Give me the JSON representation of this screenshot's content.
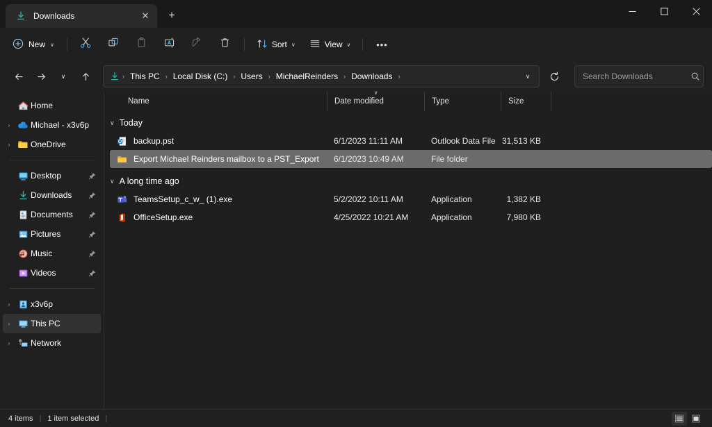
{
  "window": {
    "minimize_label": "Minimize",
    "maximize_label": "Maximize",
    "close_label": "Close"
  },
  "tabs": {
    "items": [
      {
        "label": "Downloads",
        "icon": "download-icon",
        "active": true
      }
    ],
    "close_label": "✕",
    "new_tab_label": "+"
  },
  "toolbar": {
    "new_label": "New",
    "new_chevron": "∨",
    "cut_label": "Cut",
    "copy_label": "Copy",
    "paste_label": "Paste",
    "rename_label": "Rename",
    "share_label": "Share",
    "delete_label": "Delete",
    "sort_label": "Sort",
    "sort_chevron": "∨",
    "view_label": "View",
    "view_chevron": "∨",
    "more_label": "•••"
  },
  "addressbar": {
    "back_label": "←",
    "forward_label": "→",
    "recent_chevron": "∨",
    "up_label": "↑",
    "refresh_label": "↻",
    "breadcrumb_separator": "›",
    "crumbs": [
      {
        "label": "This PC"
      },
      {
        "label": "Local Disk (C:)"
      },
      {
        "label": "Users"
      },
      {
        "label": "MichaelReinders"
      },
      {
        "label": "Downloads"
      }
    ],
    "dropdown_chevron": "∨"
  },
  "search": {
    "placeholder": "Search Downloads",
    "value": ""
  },
  "sidebar": {
    "groups": [
      {
        "items": [
          {
            "label": "Home",
            "icon": "home-icon",
            "expandable": false,
            "pinned": false,
            "selected": false
          },
          {
            "label": "Michael - x3v6p",
            "icon": "onedrive-cloud-icon",
            "expandable": true,
            "pinned": false,
            "selected": false
          },
          {
            "label": "OneDrive",
            "icon": "onedrive-folder-icon",
            "expandable": true,
            "pinned": false,
            "selected": false
          }
        ]
      },
      {
        "items": [
          {
            "label": "Desktop",
            "icon": "desktop-icon",
            "expandable": false,
            "pinned": true,
            "selected": false
          },
          {
            "label": "Downloads",
            "icon": "download-icon",
            "expandable": false,
            "pinned": true,
            "selected": false
          },
          {
            "label": "Documents",
            "icon": "documents-icon",
            "expandable": false,
            "pinned": true,
            "selected": false
          },
          {
            "label": "Pictures",
            "icon": "pictures-icon",
            "expandable": false,
            "pinned": true,
            "selected": false
          },
          {
            "label": "Music",
            "icon": "music-icon",
            "expandable": false,
            "pinned": true,
            "selected": false
          },
          {
            "label": "Videos",
            "icon": "videos-icon",
            "expandable": false,
            "pinned": true,
            "selected": false
          }
        ]
      },
      {
        "items": [
          {
            "label": "x3v6p",
            "icon": "pc-icon",
            "expandable": true,
            "pinned": false,
            "selected": false
          },
          {
            "label": "This PC",
            "icon": "this-pc-icon",
            "expandable": true,
            "pinned": false,
            "selected": true
          },
          {
            "label": "Network",
            "icon": "network-icon",
            "expandable": true,
            "pinned": false,
            "selected": false
          }
        ]
      }
    ],
    "expand_chevron": "›",
    "pin_glyph": "📌"
  },
  "columns": [
    {
      "key": "name",
      "label": "Name",
      "sorted": false
    },
    {
      "key": "date",
      "label": "Date modified",
      "sorted": true
    },
    {
      "key": "type",
      "label": "Type",
      "sorted": false
    },
    {
      "key": "size",
      "label": "Size",
      "sorted": false
    }
  ],
  "sort_indicator": "∨",
  "groups": [
    {
      "name": "Today",
      "chevron": "∨",
      "rows": [
        {
          "name": "backup.pst",
          "date": "6/1/2023 11:11 AM",
          "type": "Outlook Data File",
          "size": "31,513 KB",
          "icon": "outlook-data-file-icon",
          "selected": false
        },
        {
          "name": "Export Michael Reinders mailbox to a PST_Export",
          "date": "6/1/2023 10:49 AM",
          "type": "File folder",
          "size": "",
          "icon": "folder-icon",
          "selected": true
        }
      ]
    },
    {
      "name": "A long time ago",
      "chevron": "∨",
      "rows": [
        {
          "name": "TeamsSetup_c_w_ (1).exe",
          "date": "5/2/2022 10:11 AM",
          "type": "Application",
          "size": "1,382 KB",
          "icon": "teams-icon",
          "selected": false
        },
        {
          "name": "OfficeSetup.exe",
          "date": "4/25/2022 10:21 AM",
          "type": "Application",
          "size": "7,980 KB",
          "icon": "office-icon",
          "selected": false
        }
      ]
    }
  ],
  "statusbar": {
    "item_count": "4 items",
    "selection": "1 item selected",
    "separator": "|",
    "details_view_label": "Details view",
    "icons_view_label": "Large icons view"
  },
  "colors": {
    "accent": "#4cc2ff",
    "selection_bg": "#6b6b6b",
    "window_bg": "#202020",
    "content_bg": "#1f1f1f",
    "folder_yellow": "#ffc83d",
    "outlook_blue": "#0f6cbd",
    "teams_purple": "#5b5fc7",
    "office_orange": "#d83b01",
    "download_teal": "#2fb6a3"
  }
}
